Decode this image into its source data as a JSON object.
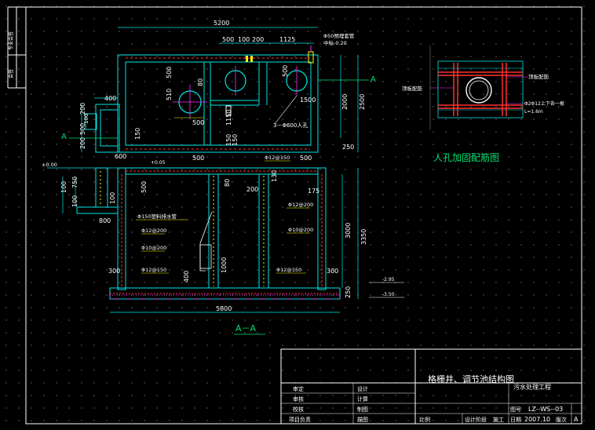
{
  "plan": {
    "dims": {
      "total_length": "5200",
      "seg1": "500",
      "seg2": "100",
      "seg3": "200",
      "seg4": "1125",
      "width_outer": "2500",
      "width_inner": "2000",
      "d400": "400",
      "d200": "200",
      "d100": "100",
      "d200b": "200",
      "d500left": "500",
      "d150": "150",
      "d500a": "500",
      "d510": "510",
      "d80": "80",
      "d500b": "500",
      "d500c": "500",
      "d1500": "1500",
      "d1150": "1150",
      "d150b": "150",
      "d150c": "150",
      "d250": "250"
    },
    "pipe_note": "Φ50预埋套管",
    "pipe_note2": "中标-0.20",
    "manhole_note": "3－Φ600人孔",
    "section_mark": "A"
  },
  "section": {
    "title": "A－A",
    "dims": {
      "total": "5800",
      "d600": "600",
      "d500": "500",
      "d500b": "500",
      "d500c": "500",
      "d80": "80",
      "d200": "200",
      "d130": "130",
      "d175": "175",
      "d100": "100",
      "d750": "750",
      "d100b": "100",
      "d100c": "100",
      "d800": "800",
      "d300": "300",
      "d400": "400",
      "d1000": "1000",
      "d300b": "300",
      "h3000": "3000",
      "h3350": "3350",
      "h250": "250"
    },
    "elev_top": "±0.00",
    "elev_a": "+0.05",
    "elev_b": "-2.95",
    "elev_c": "-3.50",
    "rebar1": "Φ12@150",
    "rebar2": "Φ12@200",
    "rebar3": "Φ12@200",
    "rebar4": "Φ10@200",
    "rebar5": "Φ12@150",
    "rebar6": "Φ12@150",
    "rebar7": "Φ12@200",
    "rebar8": "Φ10@200",
    "rebar9": "Φ12@200",
    "pipe_label": "Φ150塑料排水管"
  },
  "detail": {
    "title": "人孔加固配筋图",
    "label_left": "顶板配筋",
    "label_right": "顶板配筋",
    "label_bar": "Φ2Φ12上下各一根",
    "label_len": "L=1.6m"
  },
  "titleblock": {
    "title": "格栅井、调节池结构图",
    "project": "污水处理工程",
    "drawing_no_label": "图号",
    "drawing_no": "LZ--WS--03",
    "date_label": "日期",
    "date": "2007.10",
    "version_label": "版次",
    "version": "A",
    "rows_left": [
      "审定",
      "审核",
      "校核",
      "项目负责"
    ],
    "rows_mid": [
      "设计",
      "计算",
      "制图",
      "描图"
    ],
    "scale_label": "比例",
    "stage_label": "设计阶段",
    "stage": "施工"
  },
  "side_strip": {
    "label1": "专业会签",
    "label2": "会签"
  }
}
